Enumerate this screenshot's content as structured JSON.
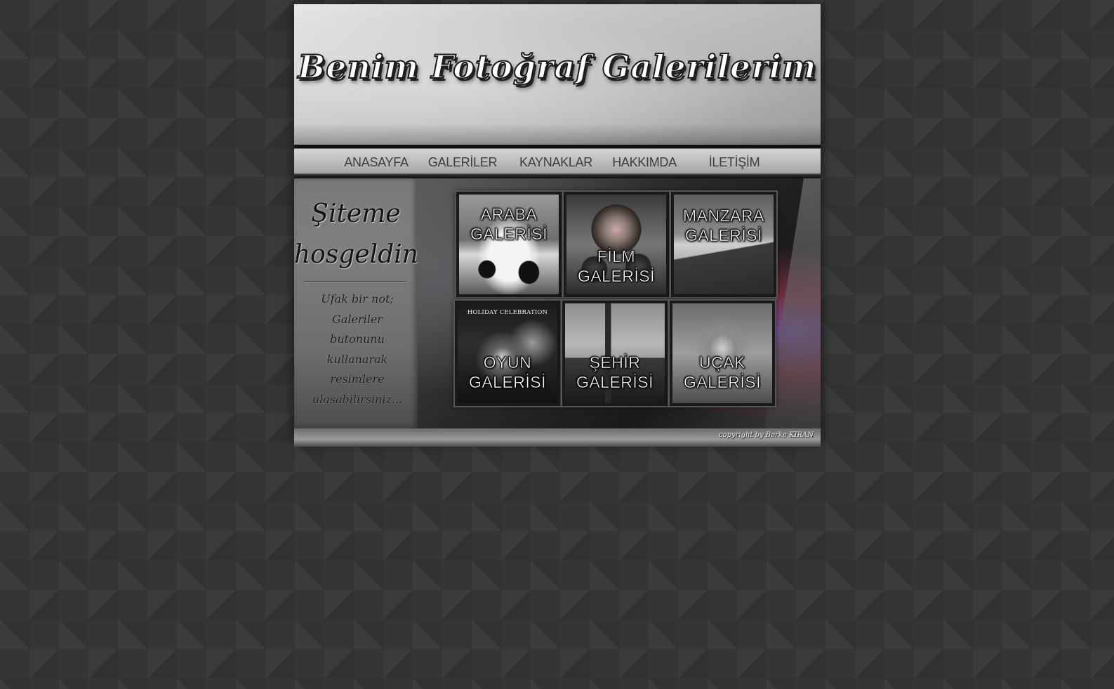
{
  "header": {
    "title": "Benim Fotoğraf Galerilerim"
  },
  "nav": {
    "items": [
      {
        "label": "ANASAYFA"
      },
      {
        "label": "GALERİLER"
      },
      {
        "label": "KAYNAKLAR"
      },
      {
        "label": "HAKKIMDA"
      },
      {
        "label": "İLETİŞİM"
      }
    ]
  },
  "sidebar": {
    "welcome_line1": "Şiteme",
    "welcome_line2": "hosgeldiniz",
    "note_lines": [
      "Ufak bir not;",
      "Galeriler",
      "butonunu",
      "kullanarak",
      "resimlere",
      "ulasabilirsiniz..."
    ]
  },
  "gallery": {
    "tiles": [
      {
        "line1": "ARABA",
        "line2": "GALERİSİ",
        "icon": "car-photo"
      },
      {
        "line1": "FİLM",
        "line2": "GALERİSİ",
        "icon": "film-photo"
      },
      {
        "line1": "MANZARA",
        "line2": "GALERİSİ",
        "icon": "landscape-photo"
      },
      {
        "line1": "OYUN",
        "line2": "GALERİSİ",
        "icon": "game-photo",
        "caption": "HOLIDAY CELEBRATION"
      },
      {
        "line1": "ŞEHİR",
        "line2": "GALERİSİ",
        "icon": "city-photo"
      },
      {
        "line1": "UÇAK",
        "line2": "GALERİSİ",
        "icon": "plane-photo"
      }
    ]
  },
  "footer": {
    "copyright": "copyright by Berke KIRAN"
  }
}
